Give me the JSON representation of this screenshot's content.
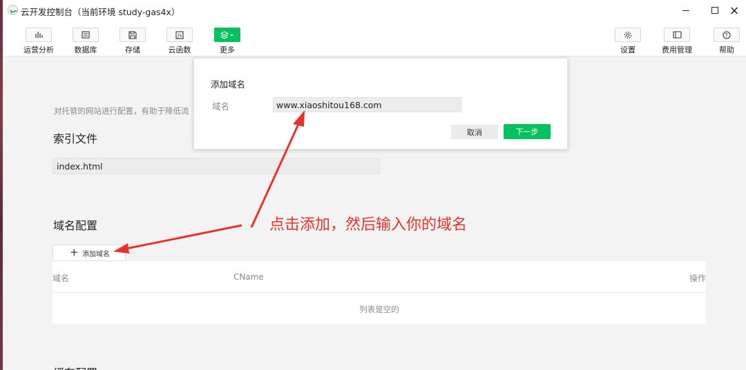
{
  "window": {
    "title": "云开发控制台（当前环境 study-gas4x）",
    "controls": {
      "minimize": "minimize-icon",
      "maximize": "maximize-icon",
      "close": "×"
    }
  },
  "toolbar": {
    "left": [
      {
        "label": "运营分析",
        "icon": "bar-chart-icon"
      },
      {
        "label": "数据库",
        "icon": "database-icon"
      },
      {
        "label": "存储",
        "icon": "save-icon"
      },
      {
        "label": "云函数",
        "icon": "function-icon"
      },
      {
        "label": "更多",
        "icon": "layers-icon",
        "active": true
      }
    ],
    "right": [
      {
        "label": "设置",
        "icon": "gear-icon"
      },
      {
        "label": "费用管理",
        "icon": "billing-icon"
      },
      {
        "label": "帮助",
        "icon": "help-icon"
      }
    ],
    "accent": "#07c160"
  },
  "page": {
    "description": "对托管的网站进行配置，有助于降低流",
    "index_heading": "索引文件",
    "index_value": "index.html",
    "domain_heading": "域名配置",
    "add_domain_label": "添加域名",
    "table": {
      "columns": [
        "域名",
        "CName",
        "操作"
      ],
      "empty_text": "列表是空的"
    },
    "cache_heading": "缓存配置"
  },
  "modal": {
    "title": "添加域名",
    "field_label": "域名",
    "field_value": "www.xiaoshitou168.com",
    "cancel_label": "取消",
    "next_label": "下一步"
  },
  "annotation": {
    "text": "点击添加，然后输入你的域名",
    "color": "#e8322b"
  }
}
